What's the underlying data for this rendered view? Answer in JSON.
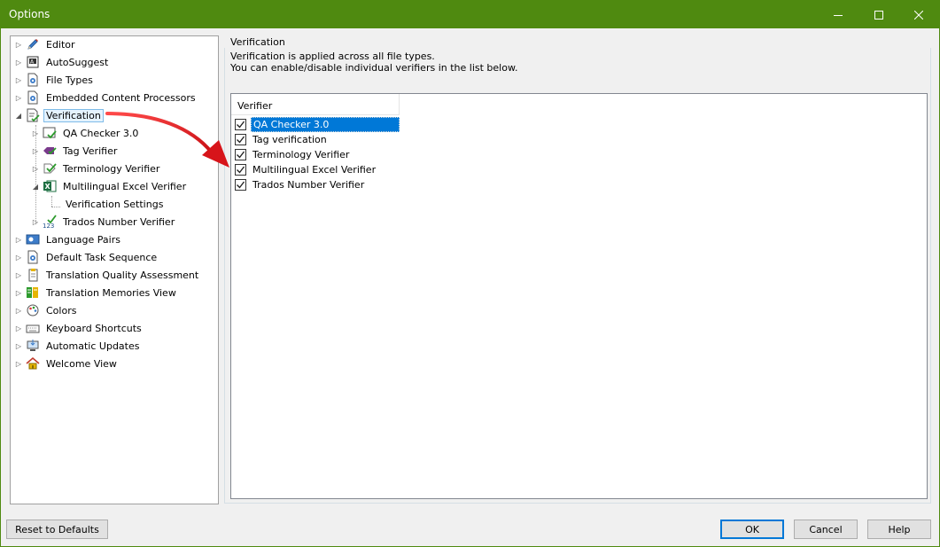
{
  "window": {
    "title": "Options"
  },
  "tree": {
    "items": [
      {
        "label": "Editor",
        "icon": "pencil-icon"
      },
      {
        "label": "AutoSuggest",
        "icon": "autosuggest-icon"
      },
      {
        "label": "File Types",
        "icon": "file-types-icon"
      },
      {
        "label": "Embedded Content Processors",
        "icon": "embedded-content-icon"
      },
      {
        "label": "Verification",
        "icon": "verification-icon",
        "selected": true,
        "expanded": true
      },
      {
        "label": "QA Checker 3.0",
        "icon": "qa-checker-icon"
      },
      {
        "label": "Tag Verifier",
        "icon": "tag-verifier-icon"
      },
      {
        "label": "Terminology Verifier",
        "icon": "terminology-verifier-icon"
      },
      {
        "label": "Multilingual Excel Verifier",
        "icon": "excel-icon",
        "expanded": true
      },
      {
        "label": "Verification Settings",
        "icon": ""
      },
      {
        "label": "Trados Number Verifier",
        "icon": "number-verifier-icon"
      },
      {
        "label": "Language Pairs",
        "icon": "language-pairs-icon"
      },
      {
        "label": "Default Task Sequence",
        "icon": "task-sequence-icon"
      },
      {
        "label": "Translation Quality Assessment",
        "icon": "quality-assessment-icon"
      },
      {
        "label": "Translation Memories View",
        "icon": "translation-memories-icon"
      },
      {
        "label": "Colors",
        "icon": "colors-icon"
      },
      {
        "label": "Keyboard Shortcuts",
        "icon": "keyboard-icon"
      },
      {
        "label": "Automatic Updates",
        "icon": "updates-icon"
      },
      {
        "label": "Welcome View",
        "icon": "home-icon"
      }
    ]
  },
  "panel": {
    "group_title": "Verification",
    "description_line1": "Verification is applied across all file types.",
    "description_line2": "You can enable/disable individual verifiers in the list below.",
    "list_header": "Verifier",
    "verifiers": [
      {
        "label": "QA Checker 3.0",
        "checked": true,
        "selected": true
      },
      {
        "label": "Tag verification",
        "checked": true
      },
      {
        "label": "Terminology Verifier",
        "checked": true
      },
      {
        "label": "Multilingual Excel Verifier",
        "checked": true
      },
      {
        "label": "Trados Number Verifier",
        "checked": true
      }
    ]
  },
  "buttons": {
    "reset": "Reset to Defaults",
    "ok": "OK",
    "cancel": "Cancel",
    "help": "Help"
  },
  "colors": {
    "titlebar": "#4f8a10",
    "selection": "#0078d7",
    "arrow": "#e8141b"
  }
}
